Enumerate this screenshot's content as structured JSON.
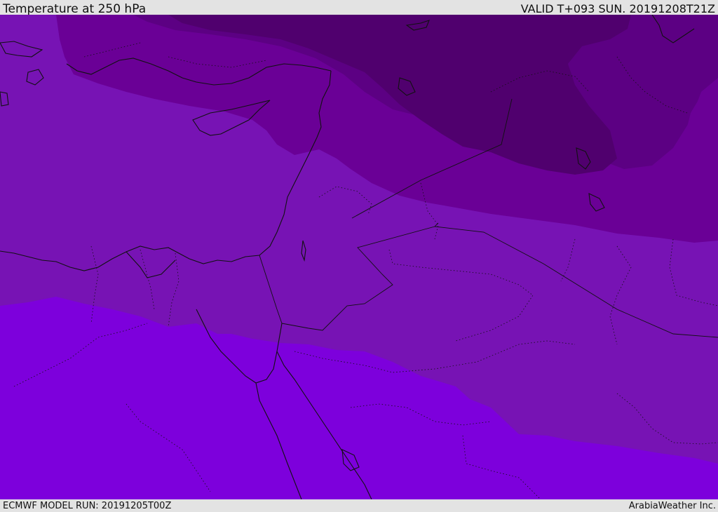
{
  "header": {
    "title": "Temperature at 250 hPa",
    "valid": "VALID T+093 SUN. 20191208T21Z"
  },
  "footer": {
    "model_run": "ECMWF MODEL RUN: 20191205T00Z",
    "credit": "ArabiaWeather Inc."
  },
  "map": {
    "field": "temperature",
    "level": "250 hPa",
    "region": "Eastern Mediterranean, Levant, Egypt, Iraq",
    "colors": {
      "warmest_band": "#7d00dc",
      "band_2": "#7713b4",
      "band_3": "#6a0096",
      "band_4": "#5c0083",
      "coldest_band": "#50006e",
      "coastline": "#111111"
    }
  }
}
